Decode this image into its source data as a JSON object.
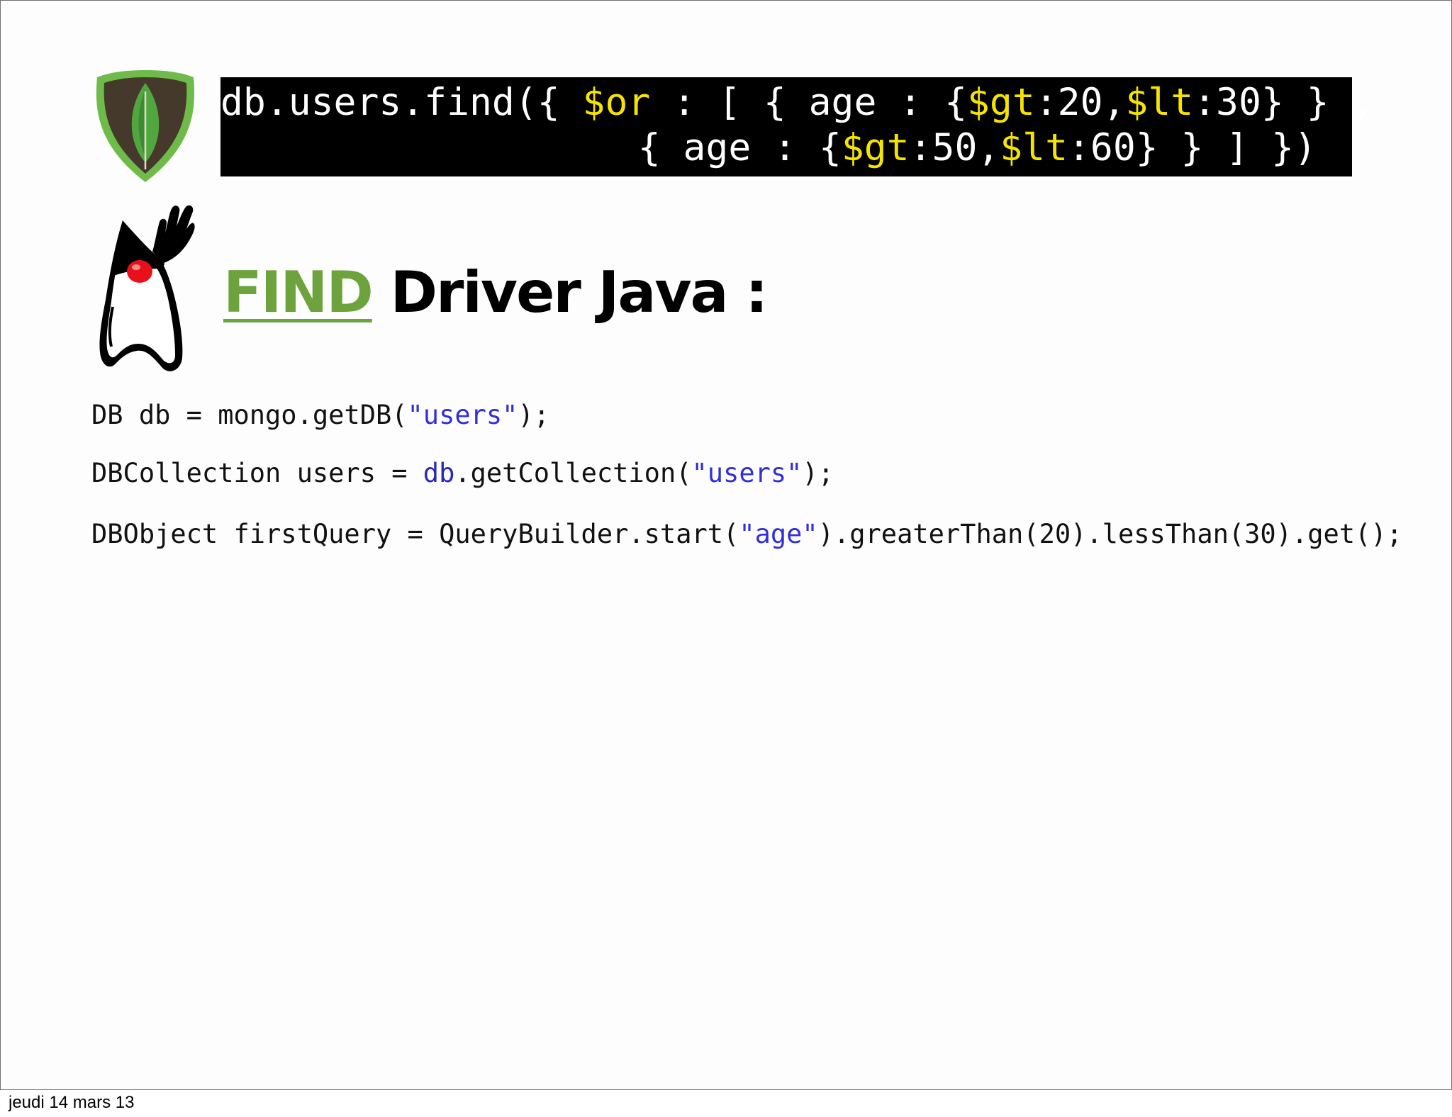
{
  "header": {
    "query_line1": {
      "a": "db.users.find({ ",
      "b": "$or",
      "c": " : [ { age : {",
      "d": "$gt",
      "e": ":20,",
      "f": "$lt",
      "g": ":30} } ,"
    },
    "query_line2": {
      "a": "{ age : {",
      "b": "$gt",
      "c": ":50,",
      "d": "$lt",
      "e": ":60} } ] })"
    }
  },
  "title": {
    "find": "FIND",
    "rest": " Driver Java :"
  },
  "code": {
    "line1": {
      "a": "DB db = mongo.getDB(",
      "b": "\"users\"",
      "c": ");"
    },
    "line2": {
      "a": "DBCollection users = ",
      "b": "db",
      "c": ".getCollection(",
      "d": "\"users\"",
      "e": ");"
    },
    "line3": {
      "a": "DBObject firstQuery = QueryBuilder.start(",
      "b": "\"age\"",
      "c": ").greaterThan(20).lessThan(30).get();"
    }
  },
  "footer": {
    "date": "jeudi 14 mars 13"
  },
  "colors": {
    "banner_bg": "#000000",
    "operator_yellow": "#f5e400",
    "find_green": "#6da33c",
    "string_blue": "#3030d6"
  },
  "icons": {
    "mongo": "mongodb-leaf-shield-icon",
    "java": "java-duke-mascot-icon"
  }
}
